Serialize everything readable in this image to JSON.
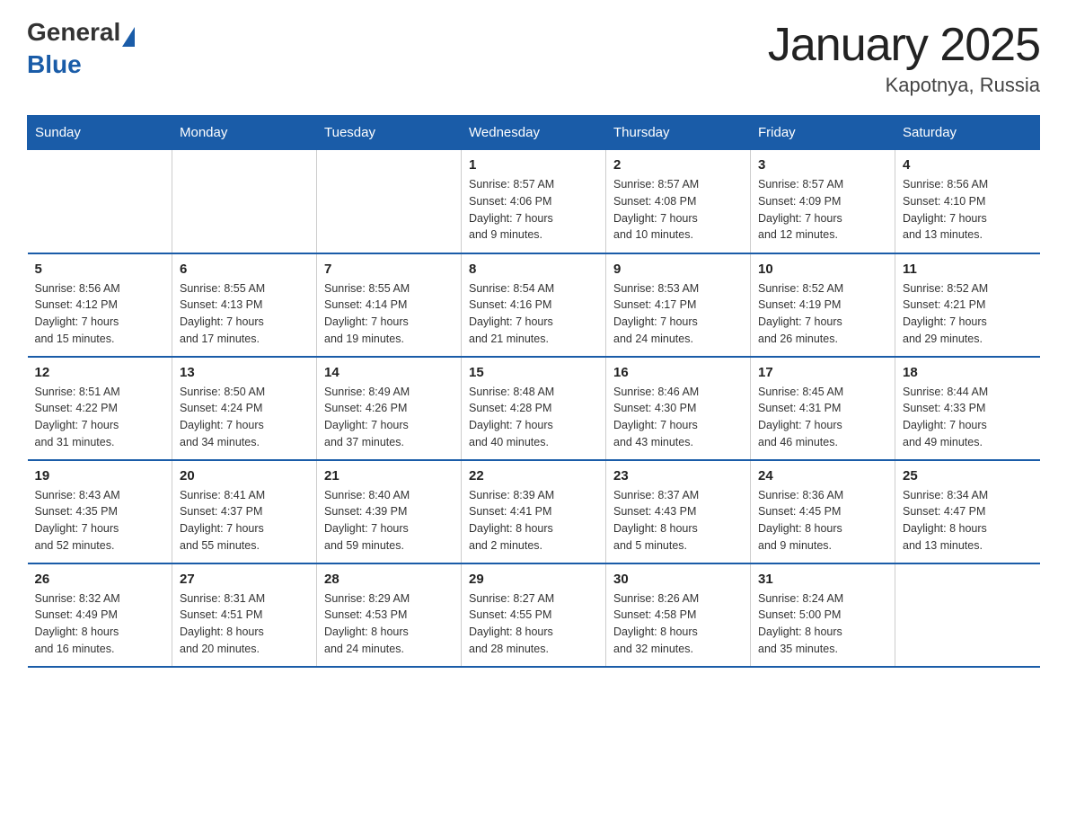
{
  "logo": {
    "general": "General",
    "blue": "Blue"
  },
  "title": "January 2025",
  "subtitle": "Kapotnya, Russia",
  "days_of_week": [
    "Sunday",
    "Monday",
    "Tuesday",
    "Wednesday",
    "Thursday",
    "Friday",
    "Saturday"
  ],
  "weeks": [
    [
      {
        "day": "",
        "info": ""
      },
      {
        "day": "",
        "info": ""
      },
      {
        "day": "",
        "info": ""
      },
      {
        "day": "1",
        "info": "Sunrise: 8:57 AM\nSunset: 4:06 PM\nDaylight: 7 hours\nand 9 minutes."
      },
      {
        "day": "2",
        "info": "Sunrise: 8:57 AM\nSunset: 4:08 PM\nDaylight: 7 hours\nand 10 minutes."
      },
      {
        "day": "3",
        "info": "Sunrise: 8:57 AM\nSunset: 4:09 PM\nDaylight: 7 hours\nand 12 minutes."
      },
      {
        "day": "4",
        "info": "Sunrise: 8:56 AM\nSunset: 4:10 PM\nDaylight: 7 hours\nand 13 minutes."
      }
    ],
    [
      {
        "day": "5",
        "info": "Sunrise: 8:56 AM\nSunset: 4:12 PM\nDaylight: 7 hours\nand 15 minutes."
      },
      {
        "day": "6",
        "info": "Sunrise: 8:55 AM\nSunset: 4:13 PM\nDaylight: 7 hours\nand 17 minutes."
      },
      {
        "day": "7",
        "info": "Sunrise: 8:55 AM\nSunset: 4:14 PM\nDaylight: 7 hours\nand 19 minutes."
      },
      {
        "day": "8",
        "info": "Sunrise: 8:54 AM\nSunset: 4:16 PM\nDaylight: 7 hours\nand 21 minutes."
      },
      {
        "day": "9",
        "info": "Sunrise: 8:53 AM\nSunset: 4:17 PM\nDaylight: 7 hours\nand 24 minutes."
      },
      {
        "day": "10",
        "info": "Sunrise: 8:52 AM\nSunset: 4:19 PM\nDaylight: 7 hours\nand 26 minutes."
      },
      {
        "day": "11",
        "info": "Sunrise: 8:52 AM\nSunset: 4:21 PM\nDaylight: 7 hours\nand 29 minutes."
      }
    ],
    [
      {
        "day": "12",
        "info": "Sunrise: 8:51 AM\nSunset: 4:22 PM\nDaylight: 7 hours\nand 31 minutes."
      },
      {
        "day": "13",
        "info": "Sunrise: 8:50 AM\nSunset: 4:24 PM\nDaylight: 7 hours\nand 34 minutes."
      },
      {
        "day": "14",
        "info": "Sunrise: 8:49 AM\nSunset: 4:26 PM\nDaylight: 7 hours\nand 37 minutes."
      },
      {
        "day": "15",
        "info": "Sunrise: 8:48 AM\nSunset: 4:28 PM\nDaylight: 7 hours\nand 40 minutes."
      },
      {
        "day": "16",
        "info": "Sunrise: 8:46 AM\nSunset: 4:30 PM\nDaylight: 7 hours\nand 43 minutes."
      },
      {
        "day": "17",
        "info": "Sunrise: 8:45 AM\nSunset: 4:31 PM\nDaylight: 7 hours\nand 46 minutes."
      },
      {
        "day": "18",
        "info": "Sunrise: 8:44 AM\nSunset: 4:33 PM\nDaylight: 7 hours\nand 49 minutes."
      }
    ],
    [
      {
        "day": "19",
        "info": "Sunrise: 8:43 AM\nSunset: 4:35 PM\nDaylight: 7 hours\nand 52 minutes."
      },
      {
        "day": "20",
        "info": "Sunrise: 8:41 AM\nSunset: 4:37 PM\nDaylight: 7 hours\nand 55 minutes."
      },
      {
        "day": "21",
        "info": "Sunrise: 8:40 AM\nSunset: 4:39 PM\nDaylight: 7 hours\nand 59 minutes."
      },
      {
        "day": "22",
        "info": "Sunrise: 8:39 AM\nSunset: 4:41 PM\nDaylight: 8 hours\nand 2 minutes."
      },
      {
        "day": "23",
        "info": "Sunrise: 8:37 AM\nSunset: 4:43 PM\nDaylight: 8 hours\nand 5 minutes."
      },
      {
        "day": "24",
        "info": "Sunrise: 8:36 AM\nSunset: 4:45 PM\nDaylight: 8 hours\nand 9 minutes."
      },
      {
        "day": "25",
        "info": "Sunrise: 8:34 AM\nSunset: 4:47 PM\nDaylight: 8 hours\nand 13 minutes."
      }
    ],
    [
      {
        "day": "26",
        "info": "Sunrise: 8:32 AM\nSunset: 4:49 PM\nDaylight: 8 hours\nand 16 minutes."
      },
      {
        "day": "27",
        "info": "Sunrise: 8:31 AM\nSunset: 4:51 PM\nDaylight: 8 hours\nand 20 minutes."
      },
      {
        "day": "28",
        "info": "Sunrise: 8:29 AM\nSunset: 4:53 PM\nDaylight: 8 hours\nand 24 minutes."
      },
      {
        "day": "29",
        "info": "Sunrise: 8:27 AM\nSunset: 4:55 PM\nDaylight: 8 hours\nand 28 minutes."
      },
      {
        "day": "30",
        "info": "Sunrise: 8:26 AM\nSunset: 4:58 PM\nDaylight: 8 hours\nand 32 minutes."
      },
      {
        "day": "31",
        "info": "Sunrise: 8:24 AM\nSunset: 5:00 PM\nDaylight: 8 hours\nand 35 minutes."
      },
      {
        "day": "",
        "info": ""
      }
    ]
  ]
}
